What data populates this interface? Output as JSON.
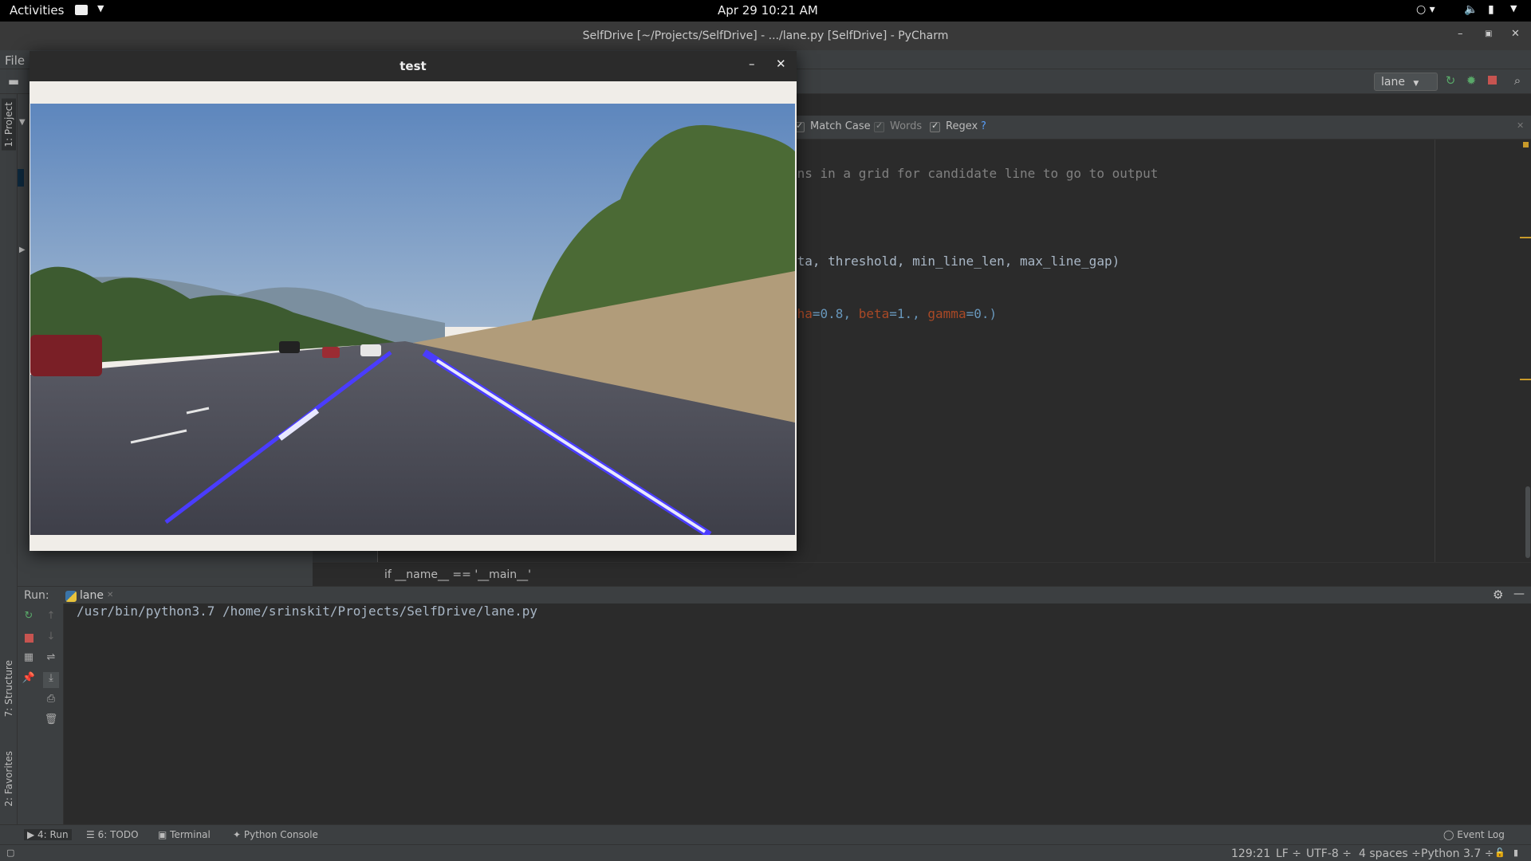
{
  "topbar": {
    "activities": "Activities",
    "clock": "Apr 29  10:21 AM"
  },
  "window": {
    "title": "SelfDrive [~/Projects/SelfDrive] - .../lane.py [SelfDrive] - PyCharm"
  },
  "menu": {
    "file": "File"
  },
  "toolbar": {
    "run_config": "lane"
  },
  "sidebar": {
    "project_tab": "1: Project",
    "structure_tab": "7: Structure",
    "favorites_tab": "2: Favorites"
  },
  "find": {
    "match_case": "Match Case",
    "words": "Words",
    "regex": "Regex",
    "help": "?"
  },
  "editor": {
    "lines": [
      {
        "comment": "ons in a grid for candidate line to go to output"
      },
      {
        "text": "eta, threshold, min_line_len, max_line_gap)"
      },
      {
        "p1": "pha",
        "v1": "=0.8, ",
        "p2": "beta",
        "v2": "=1., ",
        "p3": "gamma",
        "v3": "=0.)"
      }
    ],
    "breadcrumb": "if __name__ == '__main__'"
  },
  "run": {
    "label": "Run:",
    "tab": "lane",
    "output": "/usr/bin/python3.7 /home/srinskit/Projects/SelfDrive/lane.py"
  },
  "bottom_tabs": {
    "run": "4: Run",
    "todo": "6: TODO",
    "terminal": "Terminal",
    "console": "Python Console",
    "event_log": "Event Log"
  },
  "status": {
    "position": "129:21",
    "line_sep": "LF ÷",
    "encoding": "UTF-8 ÷",
    "indent": "4 spaces ÷",
    "interpreter": "Python 3.7 ÷"
  },
  "test_window": {
    "title": "test"
  },
  "colors": {
    "lane_line": "#4a3cff",
    "lane_highlight": "#e8e8ff",
    "sky": "#6a8fbf",
    "road": "#4c4c58"
  }
}
